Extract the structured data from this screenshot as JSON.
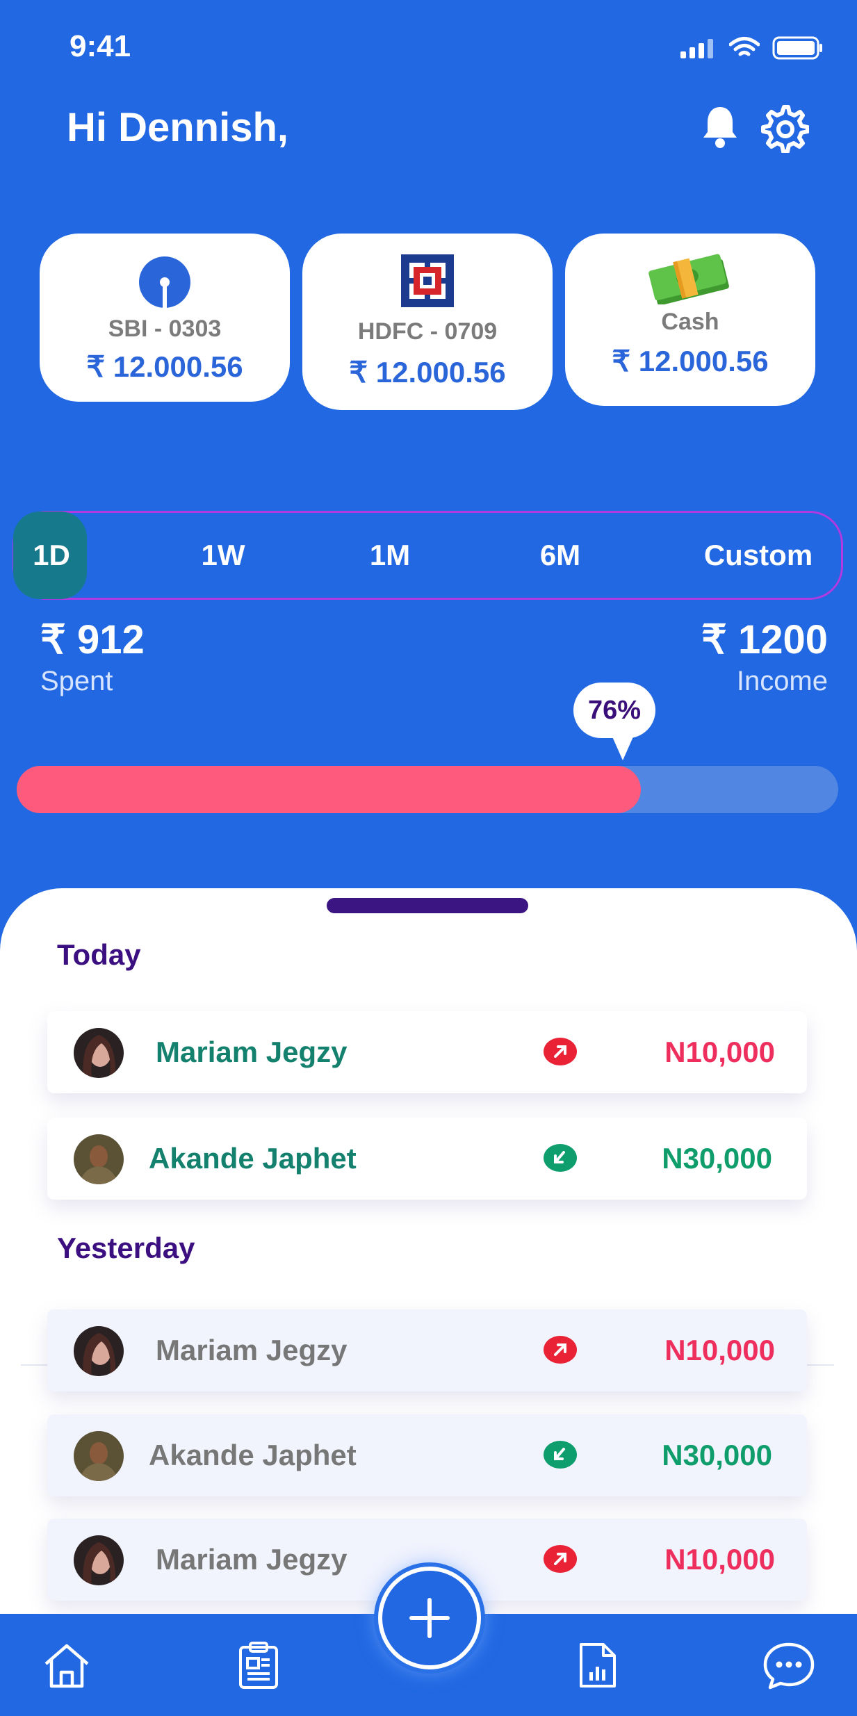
{
  "status_bar": {
    "time": "9:41"
  },
  "header": {
    "greeting": "Hi Dennish,"
  },
  "accounts": [
    {
      "name": "SBI - 0303",
      "balance": "₹ 12.000.56",
      "icon": "sbi-logo-icon"
    },
    {
      "name": "HDFC - 0709",
      "balance": "₹ 12.000.56",
      "icon": "hdfc-logo-icon"
    },
    {
      "name": "Cash",
      "balance": "₹ 12.000.56",
      "icon": "cash-icon"
    }
  ],
  "periods": {
    "items": [
      "1D",
      "1W",
      "1M",
      "6M",
      "Custom"
    ],
    "selected": "1D"
  },
  "summary": {
    "spent_amount": "₹ 912",
    "spent_label": "Spent",
    "income_amount": "₹ 1200",
    "income_label": "Income",
    "percent_label": "76%",
    "progress_fraction": 0.76
  },
  "transactions": {
    "today_label": "Today",
    "yesterday_label": "Yesterday",
    "today": [
      {
        "name": "Mariam Jegzy",
        "amount": "N10,000",
        "direction": "out"
      },
      {
        "name": "Akande Japhet",
        "amount": "N30,000",
        "direction": "in"
      }
    ],
    "yesterday": [
      {
        "name": "Mariam Jegzy",
        "amount": "N10,000",
        "direction": "out"
      },
      {
        "name": "Akande Japhet",
        "amount": "N30,000",
        "direction": "in"
      },
      {
        "name": "Mariam Jegzy",
        "amount": "N10,000",
        "direction": "out"
      }
    ]
  },
  "nav": {
    "items": [
      "home-icon",
      "clipboard-icon",
      "add-icon",
      "report-icon",
      "chat-icon"
    ]
  },
  "colors": {
    "primary": "#2168e2",
    "spent": "#fd5a7d",
    "income_green": "#0f9d6b",
    "out_red": "#ee2f5e"
  }
}
